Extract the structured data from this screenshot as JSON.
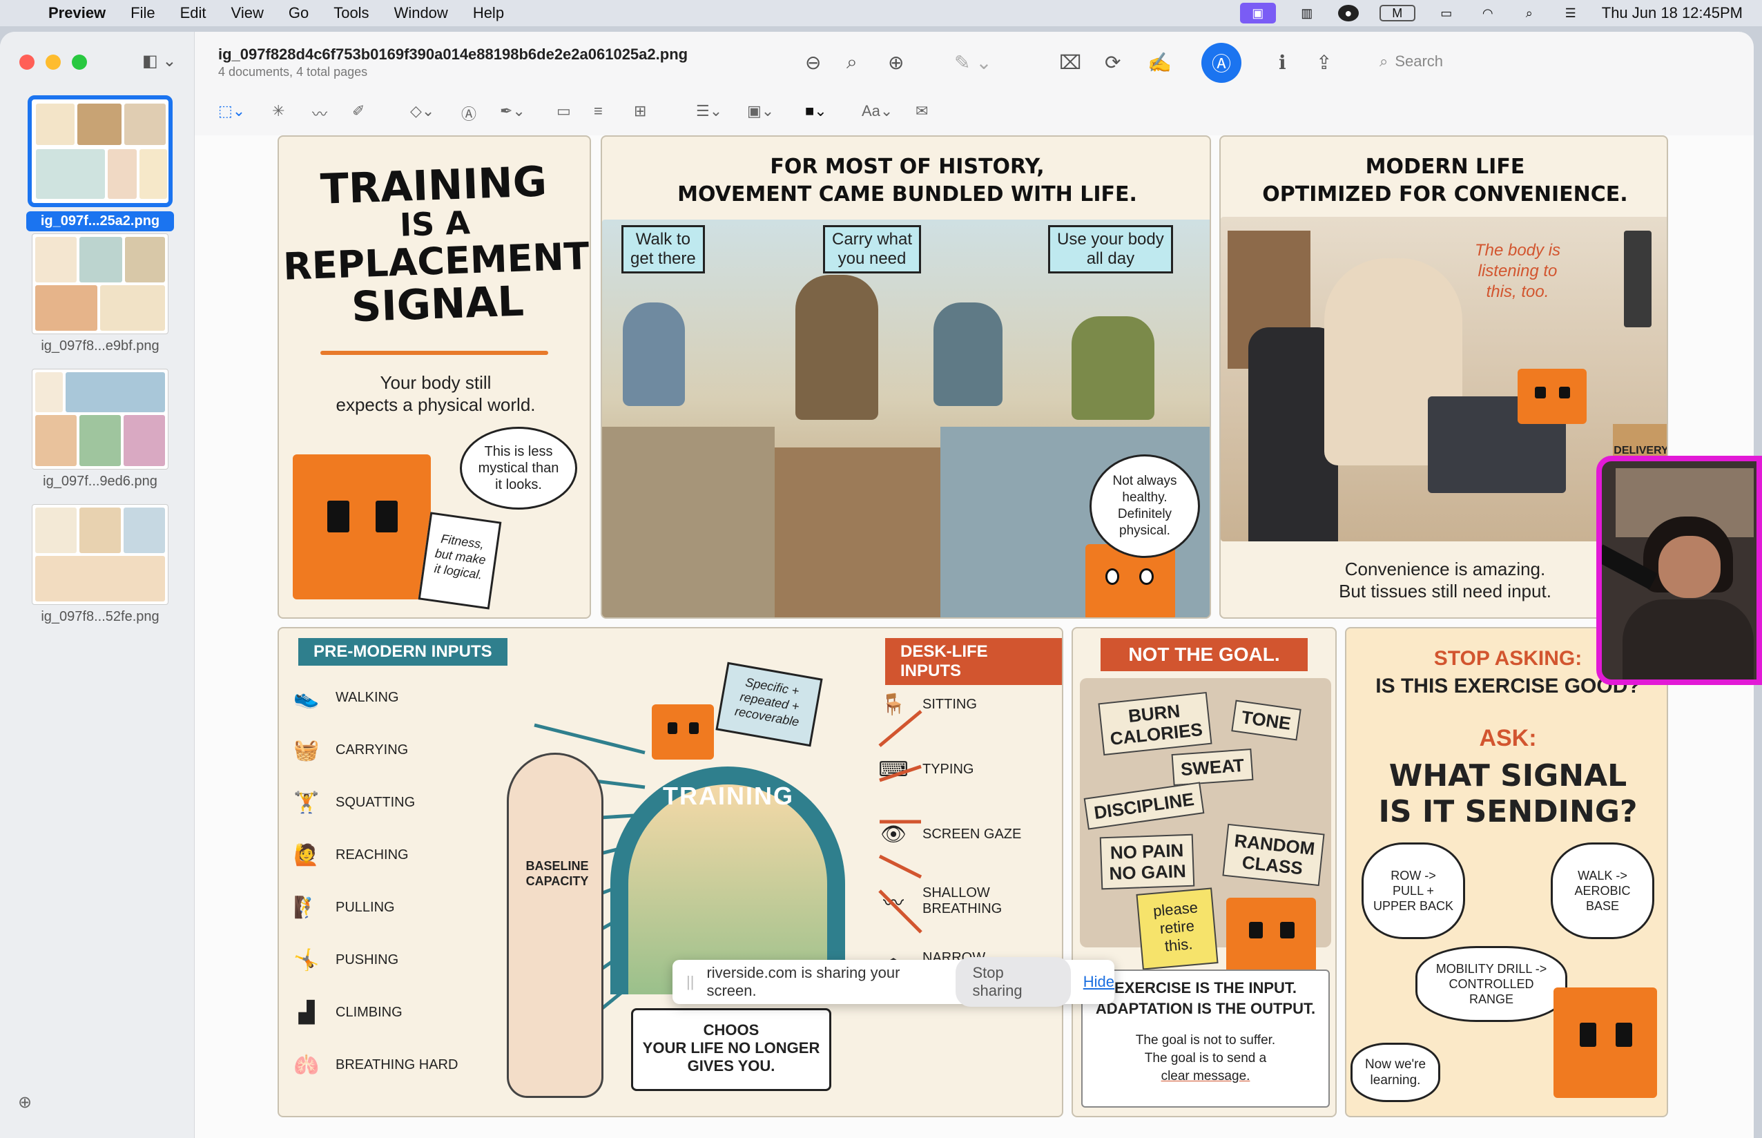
{
  "menubar": {
    "app": "Preview",
    "items": [
      "File",
      "Edit",
      "View",
      "Go",
      "Tools",
      "Window",
      "Help"
    ],
    "clock": "Thu Jun 18  12:45PM"
  },
  "window": {
    "title": "ig_097f828d4c6f753b0169f390a014e88198b6de2e2a061025a2.png",
    "subtitle": "4 documents, 4 total pages",
    "search_placeholder": "Search"
  },
  "sidebar": {
    "thumbs": [
      {
        "label": "ig_097f...25a2.png",
        "selected": true
      },
      {
        "label": "ig_097f8...e9bf.png",
        "selected": false
      },
      {
        "label": "ig_097f...9ed6.png",
        "selected": false
      },
      {
        "label": "ig_097f8...52fe.png",
        "selected": false
      }
    ]
  },
  "doc": {
    "p1": {
      "title": [
        "TRAINING",
        "IS A",
        "REPLACEMENT",
        "SIGNAL"
      ],
      "sub": [
        "Your body still",
        "expects a physical world."
      ],
      "bubble": [
        "This is less",
        "mystical than",
        "it looks."
      ],
      "clip": [
        "Fitness,",
        "but make",
        "it logical."
      ]
    },
    "p2": {
      "title": [
        "FOR MOST OF HISTORY,",
        "MOVEMENT CAME BUNDLED WITH LIFE."
      ],
      "tags": [
        [
          "Walk to",
          "get there"
        ],
        [
          "Carry what",
          "you need"
        ],
        [
          "Use your body",
          "all day"
        ]
      ],
      "bubble": [
        "Not always",
        "healthy.",
        "Definitely",
        "physical."
      ]
    },
    "p3": {
      "title": [
        "MODERN LIFE",
        "OPTIMIZED FOR CONVENIENCE."
      ],
      "note": [
        "The body is",
        "listening to",
        "this, too."
      ],
      "bag": "DELIVERY",
      "caption": [
        "Convenience is amazing.",
        "But tissues still need input."
      ]
    },
    "p4": {
      "left_head": "PRE-MODERN INPUTS",
      "left_items": [
        {
          "icon": "shoe-icon",
          "label": "WALKING"
        },
        {
          "icon": "basket-icon",
          "label": "CARRYING"
        },
        {
          "icon": "squat-icon",
          "label": "SQUATTING"
        },
        {
          "icon": "reach-icon",
          "label": "REACHING"
        },
        {
          "icon": "pull-icon",
          "label": "PULLING"
        },
        {
          "icon": "push-icon",
          "label": "PUSHING"
        },
        {
          "icon": "stairs-icon",
          "label": "CLIMBING"
        },
        {
          "icon": "lungs-icon",
          "label": "BREATHING HARD"
        }
      ],
      "right_head": "DESK-LIFE INPUTS",
      "right_items": [
        {
          "icon": "chair-icon",
          "label": "SITTING"
        },
        {
          "icon": "keyboard-icon",
          "label": "TYPING"
        },
        {
          "icon": "eye-icon",
          "label": "SCREEN GAZE"
        },
        {
          "icon": "breath-icon",
          "label": "SHALLOW\nBREATHING"
        },
        {
          "icon": "torso-icon",
          "label": "NARROW\nSHOULDER RANGE"
        }
      ],
      "flag": [
        "Specific +",
        "repeated +",
        "recoverable"
      ],
      "bridge": "TRAINING",
      "body_label": [
        "BASELINE",
        "CAPACITY"
      ],
      "sign": [
        "CHOOS",
        "YOUR LIFE NO LONGER",
        "GIVES YOU."
      ]
    },
    "p5": {
      "head": "NOT THE GOAL.",
      "stickies": [
        "BURN\nCALORIES",
        "TONE",
        "SWEAT",
        "DISCIPLINE",
        "NO PAIN\nNO GAIN",
        "RANDOM\nCLASS"
      ],
      "retire": [
        "please",
        "retire",
        "this."
      ],
      "out1": "EXERCISE IS THE INPUT.",
      "out2": "ADAPTATION IS THE OUTPUT.",
      "small": [
        "The goal is not to suffer.",
        "The goal is to send a",
        "clear message."
      ]
    },
    "p6": {
      "stop": [
        "STOP ASKING:",
        "IS THIS EXERCISE GOOD?"
      ],
      "ask": "ASK:",
      "q": [
        "WHAT SIGNAL",
        "IS IT SENDING?"
      ],
      "b1": [
        "ROW ->",
        "PULL +",
        "UPPER BACK"
      ],
      "b2": [
        "WALK ->",
        "AEROBIC",
        "BASE"
      ],
      "b3": [
        "MOBILITY DRILL ->",
        "CONTROLLED",
        "RANGE"
      ],
      "b4": [
        "Now we're",
        "learning."
      ]
    }
  },
  "share": {
    "text": "riverside.com is sharing your screen.",
    "stop": "Stop sharing",
    "hide": "Hide"
  },
  "colors": {
    "accent": "#1b74f0",
    "orange": "#f07a20",
    "teal": "#2f7f8d",
    "rust": "#d2552f",
    "cam_border": "#e21ad6"
  }
}
